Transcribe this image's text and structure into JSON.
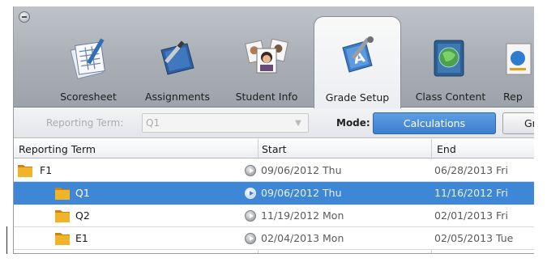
{
  "tabs": [
    {
      "label": "Scoresheet",
      "icon": "scoresheet-icon",
      "active": false
    },
    {
      "label": "Assignments",
      "icon": "assignments-icon",
      "active": false
    },
    {
      "label": "Student Info",
      "icon": "student-info-icon",
      "active": false
    },
    {
      "label": "Grade Setup",
      "icon": "grade-setup-icon",
      "active": true
    },
    {
      "label": "Class Content",
      "icon": "class-content-icon",
      "active": false
    },
    {
      "label": "Rep",
      "icon": "reports-icon",
      "active": false
    }
  ],
  "toolbar": {
    "reporting_term_label": "Reporting Term:",
    "reporting_term_value": "Q1",
    "mode_label": "Mode:",
    "mode_options": [
      "Calculations",
      "Gra"
    ],
    "mode_selected": "Calculations"
  },
  "grid": {
    "columns": [
      "Reporting Term",
      "Start",
      "End"
    ],
    "rows": [
      {
        "term": "F1",
        "start": "09/06/2012 Thu",
        "end": "06/28/2013 Fri",
        "level": 0,
        "selected": false
      },
      {
        "term": "Q1",
        "start": "09/06/2012 Thu",
        "end": "11/16/2012 Fri",
        "level": 1,
        "selected": true
      },
      {
        "term": "Q2",
        "start": "11/19/2012 Mon",
        "end": "02/01/2013 Fri",
        "level": 1,
        "selected": false
      },
      {
        "term": "E1",
        "start": "02/04/2013 Mon",
        "end": "02/05/2013 Tue",
        "level": 1,
        "selected": false
      }
    ]
  },
  "colors": {
    "selection": "#3e87d6",
    "mode_active": "#3b7ed0",
    "tabbar": "#a9aeb5",
    "folder": "#e0a21a"
  }
}
